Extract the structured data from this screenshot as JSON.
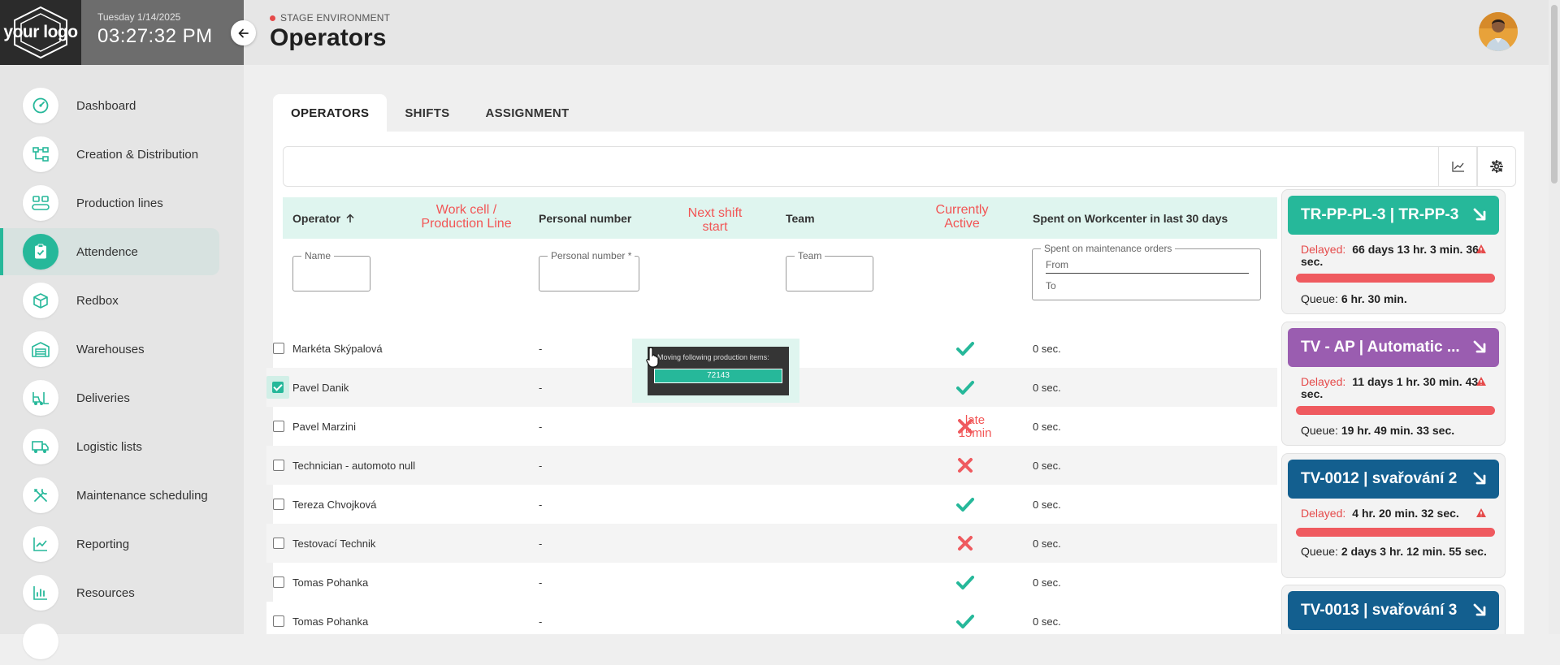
{
  "brand": {
    "logo_text": "your logo"
  },
  "clock": {
    "date": "Tuesday 1/14/2025",
    "time": "03:27:32 PM"
  },
  "header": {
    "environment": "STAGE ENVIRONMENT",
    "title": "Operators"
  },
  "sidebar": {
    "items": [
      {
        "label": "Dashboard",
        "icon": "speedometer-icon"
      },
      {
        "label": "Creation & Distribution",
        "icon": "flow-icon"
      },
      {
        "label": "Production lines",
        "icon": "production-line-icon"
      },
      {
        "label": "Attendence",
        "icon": "clipboard-icon",
        "active": true
      },
      {
        "label": "Redbox",
        "icon": "box-icon"
      },
      {
        "label": "Warehouses",
        "icon": "warehouse-icon"
      },
      {
        "label": "Deliveries",
        "icon": "forklift-icon"
      },
      {
        "label": "Logistic lists",
        "icon": "truck-icon"
      },
      {
        "label": "Maintenance scheduling",
        "icon": "tools-icon"
      },
      {
        "label": "Reporting",
        "icon": "trend-chart-icon"
      },
      {
        "label": "Resources",
        "icon": "bar-chart-icon"
      }
    ]
  },
  "tabs": [
    "OPERATORS",
    "SHIFTS",
    "ASSIGNMENT"
  ],
  "table": {
    "columns": {
      "operator": "Operator",
      "personal_number": "Personal number",
      "team": "Team",
      "spent": "Spent on Workcenter in last 30 days"
    },
    "annotations": {
      "work_cell": "Work cell / Production Line",
      "next_shift": "Next shift start",
      "currently_active": "Currently Active",
      "late": "late 15min"
    },
    "filters": {
      "name": "Name",
      "personal_number": "Personal number *",
      "team": "Team",
      "spent_maintenance": "Spent on maintenance orders",
      "from": "From",
      "to": "To"
    },
    "rows": [
      {
        "name": "Markéta Skýpalová",
        "personal": "-",
        "active": true,
        "spent": "0 sec.",
        "checked": false
      },
      {
        "name": "Pavel Danik",
        "personal": "-",
        "active": true,
        "spent": "0 sec.",
        "checked": true
      },
      {
        "name": "Pavel Marzini",
        "personal": "-",
        "active": false,
        "spent": "0 sec.",
        "checked": false
      },
      {
        "name": "Technician - automoto null",
        "personal": "-",
        "active": false,
        "spent": "0 sec.",
        "checked": false
      },
      {
        "name": "Tereza Chvojková",
        "personal": "-",
        "active": true,
        "spent": "0 sec.",
        "checked": false
      },
      {
        "name": "Testovací Technik",
        "personal": "-",
        "active": false,
        "spent": "0 sec.",
        "checked": false
      },
      {
        "name": "Tomas Pohanka",
        "personal": "-",
        "active": true,
        "spent": "0 sec.",
        "checked": false
      },
      {
        "name": "Tomas Pohanka",
        "personal": "-",
        "active": true,
        "spent": "0 sec.",
        "checked": false
      }
    ]
  },
  "tooltip": {
    "text": "Moving following production items:",
    "item": "72143"
  },
  "cards": [
    {
      "title": "TR-PP-PL-3 | TR-PP-3",
      "color": "#26b89a",
      "delayed_label": "Delayed:",
      "delayed": "66 days 13 hr. 3 min. 36 sec.",
      "queue_label": "Queue:",
      "queue": "6 hr. 30 min."
    },
    {
      "title": "TV - AP | Automatic ...",
      "color": "#9a5db0",
      "delayed_label": "Delayed:",
      "delayed": "11 days 1 hr. 30 min. 43 sec.",
      "queue_label": "Queue:",
      "queue": "19 hr. 49 min. 33 sec."
    },
    {
      "title": "TV-0012 | svařování 2",
      "color": "#135f8f",
      "delayed_label": "Delayed:",
      "delayed": "4 hr. 20 min. 32 sec.",
      "queue_label": "Queue:",
      "queue": "2 days 3 hr. 12 min. 55 sec."
    },
    {
      "title": "TV-0013 | svařování 3",
      "color": "#135f8f"
    }
  ]
}
